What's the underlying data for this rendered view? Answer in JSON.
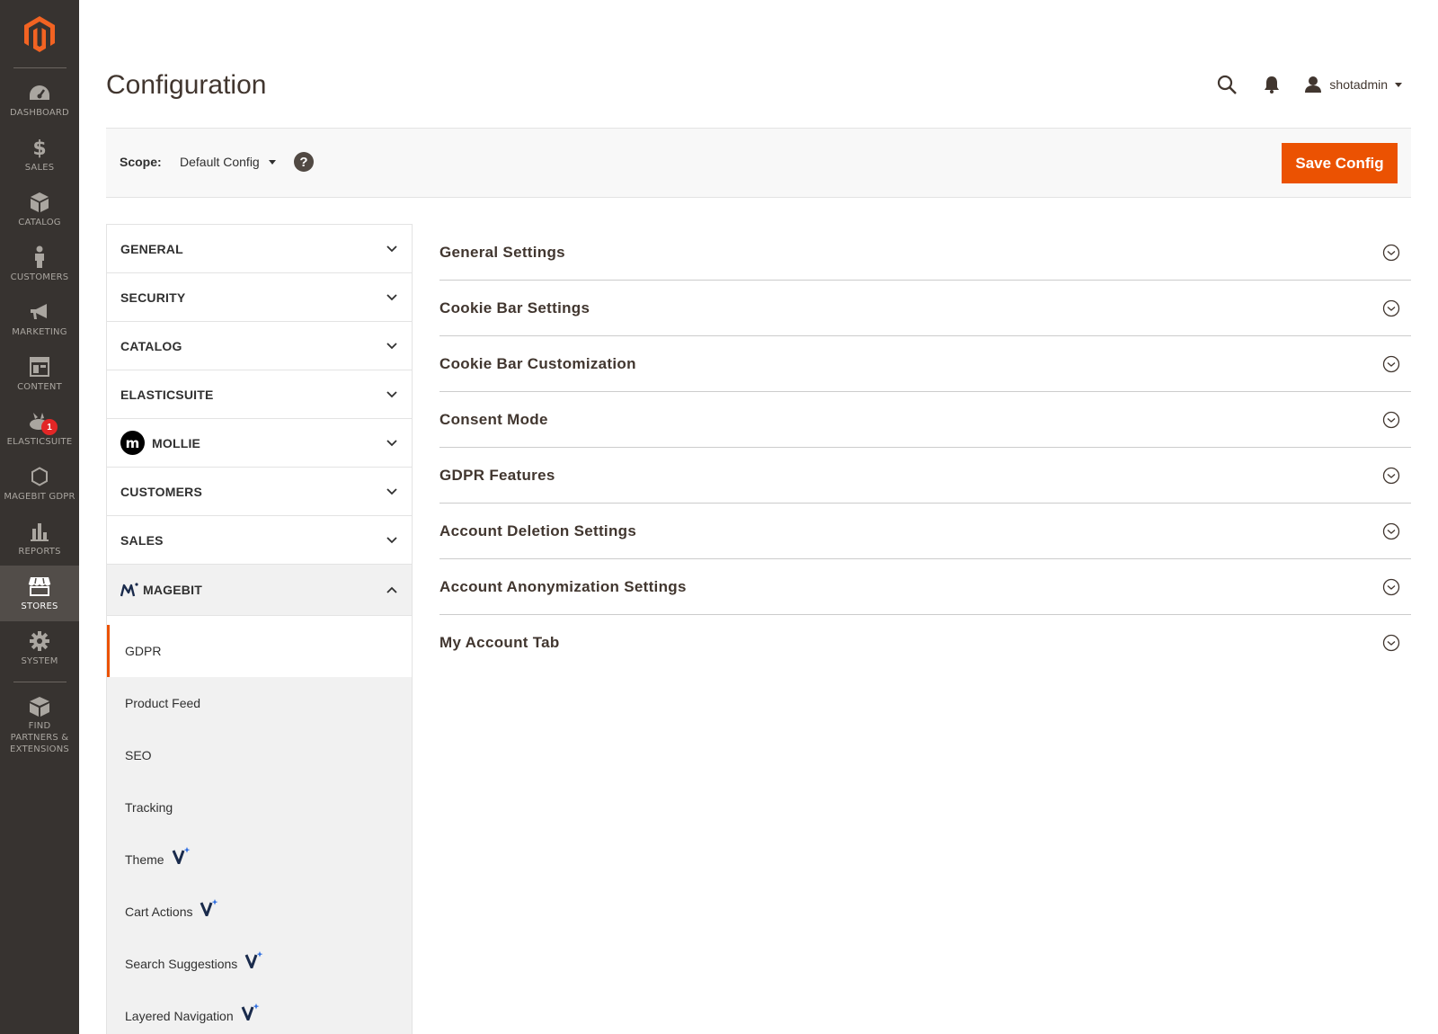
{
  "app": {
    "page_title": "Configuration"
  },
  "nav": {
    "items": [
      {
        "label": "DASHBOARD",
        "icon": "dashboard-icon"
      },
      {
        "label": "SALES",
        "icon": "dollar-icon"
      },
      {
        "label": "CATALOG",
        "icon": "box-icon"
      },
      {
        "label": "CUSTOMERS",
        "icon": "person-icon"
      },
      {
        "label": "MARKETING",
        "icon": "megaphone-icon"
      },
      {
        "label": "CONTENT",
        "icon": "layout-icon"
      },
      {
        "label": "ELASTICSUITE",
        "icon": "elasticsuite-icon",
        "badge": "1"
      },
      {
        "label": "MAGEBIT GDPR",
        "icon": "hexagon-icon"
      },
      {
        "label": "REPORTS",
        "icon": "bar-chart-icon"
      },
      {
        "label": "STORES",
        "icon": "store-icon",
        "active": true
      },
      {
        "label": "SYSTEM",
        "icon": "gear-icon"
      },
      {
        "label": "FIND PARTNERS & EXTENSIONS",
        "icon": "extensions-icon"
      }
    ]
  },
  "header": {
    "user_name": "shotadmin"
  },
  "scope": {
    "label": "Scope:",
    "value": "Default Config",
    "help": "?",
    "save_label": "Save Config"
  },
  "tabs": {
    "general": "GENERAL",
    "security": "SECURITY",
    "catalog": "CATALOG",
    "elasticsuite": "ELASTICSUITE",
    "mollie": "MOLLIE",
    "mollie_logo": "m",
    "customers": "CUSTOMERS",
    "sales": "SALES",
    "magebit": "MAGEBIT",
    "magebit_items": [
      "GDPR",
      "Product Feed",
      "SEO",
      "Tracking",
      "Theme",
      "Cart Actions",
      "Search Suggestions",
      "Layered Navigation"
    ]
  },
  "sections": [
    "General Settings",
    "Cookie Bar Settings",
    "Cookie Bar Customization",
    "Consent Mode",
    "GDPR Features",
    "Account Deletion Settings",
    "Account Anonymization Settings",
    "My Account Tab"
  ],
  "colors": {
    "accent": "#eb5202",
    "nav_bg": "#373330",
    "nav_active": "#524d49"
  }
}
